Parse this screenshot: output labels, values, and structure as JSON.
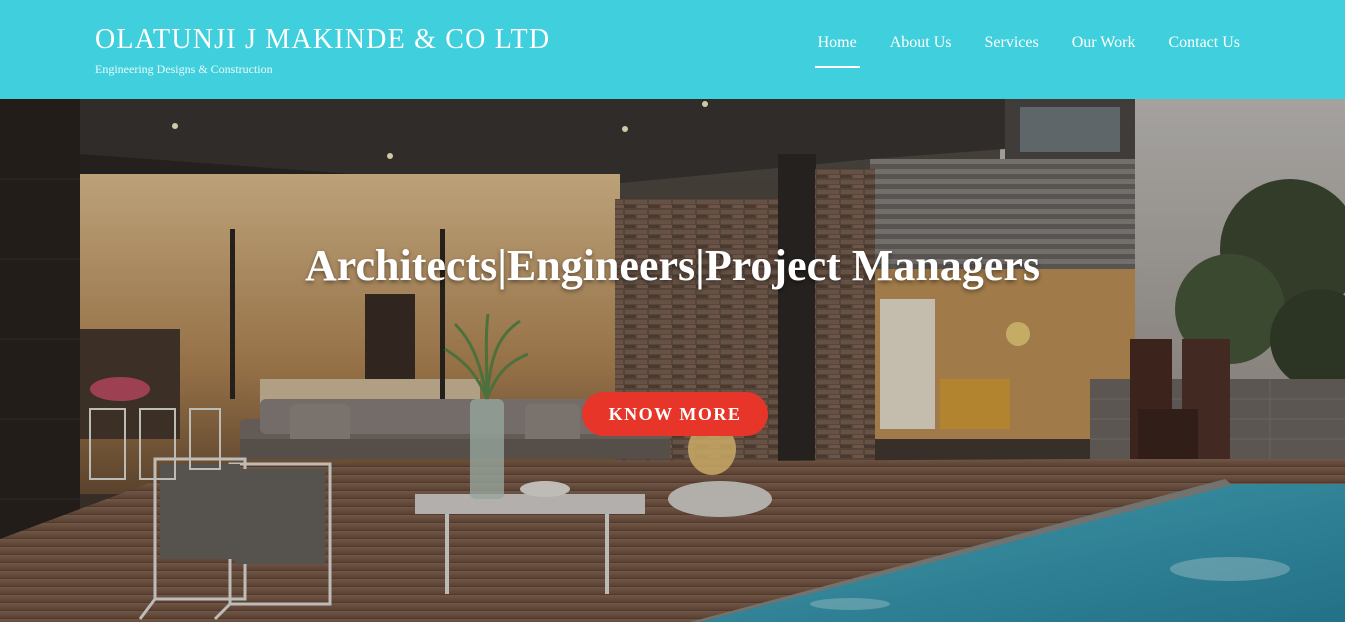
{
  "header": {
    "brand_title": "OLATUNJI J MAKINDE & CO LTD",
    "brand_tagline": "Engineering Designs & Construction",
    "background_color": "#40cfdc",
    "nav": [
      {
        "label": "Home",
        "active": true
      },
      {
        "label": "About Us",
        "active": false
      },
      {
        "label": "Services",
        "active": false
      },
      {
        "label": "Our Work",
        "active": false
      },
      {
        "label": "Contact Us",
        "active": false
      }
    ]
  },
  "hero": {
    "headline": "Architects|Engineers|Project Managers",
    "cta_label": "KNOW MORE",
    "cta_color": "#e8352a",
    "image": "modern-house-patio-with-pool"
  }
}
